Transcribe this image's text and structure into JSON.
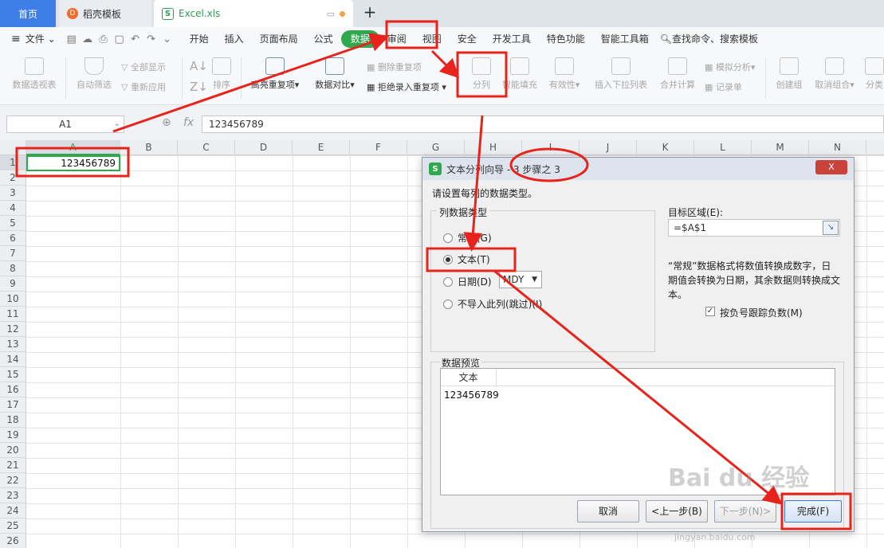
{
  "tabs": [
    {
      "label": "首页"
    },
    {
      "label": "稻壳模板",
      "icon": "daoke-icon"
    },
    {
      "label": "Excel.xls",
      "icon": "spreadsheet-icon"
    }
  ],
  "menu": {
    "file": "文件",
    "items": [
      "开始",
      "插入",
      "页面布局",
      "公式",
      "数据",
      "审阅",
      "视图",
      "安全",
      "开发工具",
      "特色功能",
      "智能工具箱"
    ],
    "active": "数据",
    "search": "查找命令、搜索模板"
  },
  "ribbon": {
    "pivot": "数据透视表",
    "autofilter": "自动筛选",
    "show_all": "全部显示",
    "reapply": "重新应用",
    "sort": "排序",
    "highlight_dup": "高亮重复项",
    "compare": "数据对比",
    "remove_dup": "删除重复项",
    "reject_dup": "拒绝录入重复项",
    "split": "分列",
    "smart_fill": "智能填充",
    "validity": "有效性",
    "insert_dropdown": "插入下拉列表",
    "consolidate": "合并计算",
    "simulate": "模拟分析",
    "record": "记录单",
    "create_group": "创建组",
    "ungroup": "取消组合",
    "subtotal": "分类"
  },
  "formula_bar": {
    "cell_ref": "A1",
    "fx": "fx",
    "value": "123456789"
  },
  "sheet": {
    "columns": [
      "A",
      "B",
      "C",
      "D",
      "E",
      "F",
      "G",
      "H",
      "I",
      "J",
      "K",
      "L",
      "M",
      "N"
    ],
    "rows": [
      "1",
      "2",
      "3",
      "4",
      "5",
      "6",
      "7",
      "8",
      "9",
      "10",
      "11",
      "12",
      "13",
      "14",
      "15",
      "16",
      "17",
      "18",
      "19",
      "20",
      "21",
      "22",
      "23",
      "24",
      "25",
      "26"
    ],
    "a1_value": "123456789"
  },
  "dialog": {
    "title": "文本分列向导 - 3 步骤之 3",
    "close": "X",
    "prompt": "请设置每列的数据类型。",
    "group_label": "列数据类型",
    "radio_general": "常规(G)",
    "radio_text": "文本(T)",
    "radio_date": "日期(D)",
    "date_format": "MDY",
    "radio_skip": "不导入此列(跳过)(I)",
    "target_label": "目标区域(E):",
    "target_value": "=$A$1",
    "info": "“常规”数据格式将数值转换成数字，日期值会转换为日期，其余数据则转换成文本。",
    "info_lines": [
      "“常规”数据格式将数值转换成数字，日",
      "期值会转换为日期，其余数据则转换成文",
      "本。"
    ],
    "checkbox_label": "按负号跟踪负数(M)",
    "preview_label": "数据预览",
    "preview_header": "文本",
    "preview_value": "123456789",
    "btn_cancel": "取消",
    "btn_back": "<上一步(B)",
    "btn_next": "下一步(N)>",
    "btn_finish": "完成(F)"
  },
  "watermark": {
    "logo": "Bai du 经验",
    "url": "jingyan.baidu.com"
  },
  "colors": {
    "accent_green": "#2fa84f",
    "annotation_red": "#e8231b",
    "tab_blue": "#3f7ee8"
  }
}
